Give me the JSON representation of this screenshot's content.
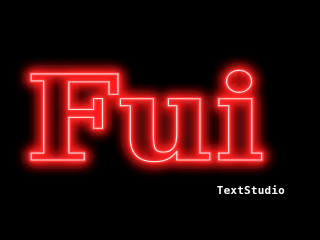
{
  "artwork": {
    "text": "Fui",
    "glow_color": "#ff2a2a",
    "core_color": "#ffe0e0",
    "background_color": "#000000"
  },
  "watermark": {
    "text": "TextStudio",
    "color": "#ffffff"
  }
}
